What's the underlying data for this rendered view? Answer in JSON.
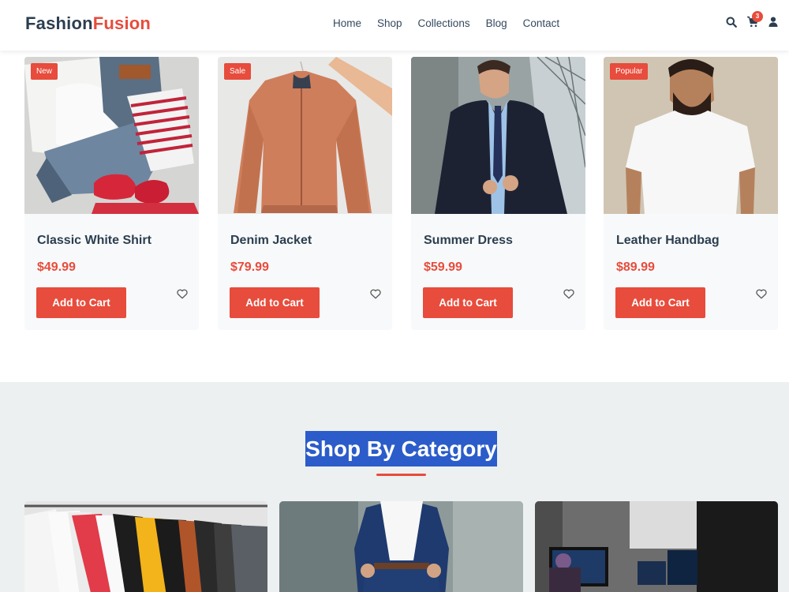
{
  "header": {
    "logo_part1": "Fashion",
    "logo_part2": "Fusion",
    "nav": [
      "Home",
      "Shop",
      "Collections",
      "Blog",
      "Contact"
    ],
    "icons": [
      "search-icon",
      "cart-icon",
      "user-icon"
    ],
    "cart_count": "3"
  },
  "products": [
    {
      "name": "Classic White Shirt",
      "price": "$49.99",
      "tag": "New",
      "button": "Add to Cart"
    },
    {
      "name": "Denim Jacket",
      "price": "$79.99",
      "tag": "Sale",
      "button": "Add to Cart"
    },
    {
      "name": "Summer Dress",
      "price": "$59.99",
      "tag": "",
      "button": "Add to Cart"
    },
    {
      "name": "Leather Handbag",
      "price": "$89.99",
      "tag": "Popular",
      "button": "Add to Cart"
    }
  ],
  "categories_section": {
    "title": "Shop By Category"
  },
  "colors": {
    "accent": "#e74c3c",
    "text": "#2c3e50",
    "section_bg": "#ecf0f1",
    "title_highlight": "#2b5cc9"
  }
}
